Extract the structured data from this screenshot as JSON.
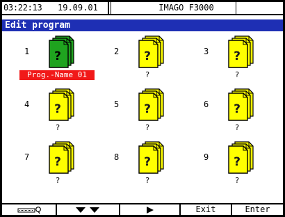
{
  "status": {
    "time": "03:22:13",
    "date": "19.09.01",
    "device": "IMAGO F3000"
  },
  "title": "Edit program",
  "programs": [
    {
      "num": "1",
      "name": "Prog.-Name 01",
      "selected": true
    },
    {
      "num": "2",
      "name": "?"
    },
    {
      "num": "3",
      "name": "?"
    },
    {
      "num": "4",
      "name": "?"
    },
    {
      "num": "5",
      "name": "?"
    },
    {
      "num": "6",
      "name": "?"
    },
    {
      "num": "7",
      "name": "?"
    },
    {
      "num": "8",
      "name": "?"
    },
    {
      "num": "9",
      "name": "?"
    }
  ],
  "icon_mark": "?",
  "colors": {
    "titlebar": "#1e2fb4",
    "selected_label": "#f11919",
    "selected_icon": "#1fa31f",
    "icon": "#ffff00"
  },
  "fkeys": {
    "exit": "Exit",
    "enter": "Enter"
  },
  "icons": {
    "f1": "key-lock-icon",
    "f2": "double-down-arrow-icon",
    "f3": "play-arrow-icon"
  }
}
